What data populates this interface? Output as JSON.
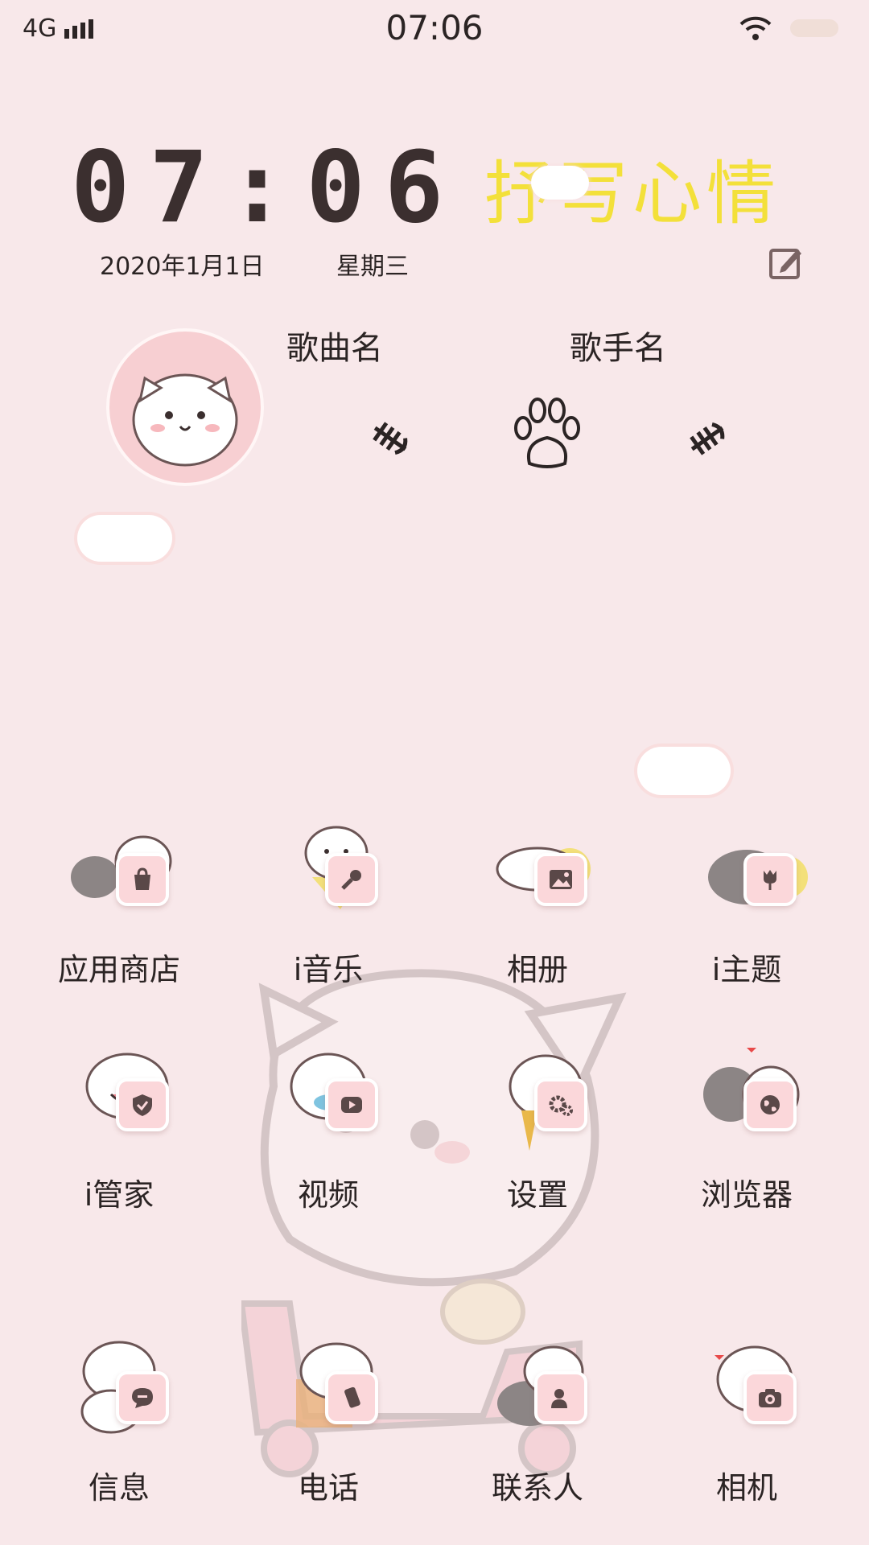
{
  "status_bar": {
    "network": "4G",
    "time": "07:06"
  },
  "clock_widget": {
    "time": "07:06",
    "mood_text": "抒写心情",
    "date": "2020年1月1日",
    "weekday": "星期三"
  },
  "music_widget": {
    "song_name": "歌曲名",
    "singer_name": "歌手名"
  },
  "apps": [
    {
      "label": "应用商店",
      "icon": "shopping-bag-icon"
    },
    {
      "label": "i音乐",
      "icon": "microphone-icon"
    },
    {
      "label": "相册",
      "icon": "photo-icon"
    },
    {
      "label": "i主题",
      "icon": "tulip-icon"
    },
    {
      "label": "i管家",
      "icon": "shield-icon"
    },
    {
      "label": "视频",
      "icon": "play-icon"
    },
    {
      "label": "设置",
      "icon": "gear-icon"
    },
    {
      "label": "浏览器",
      "icon": "globe-icon"
    },
    {
      "label": "信息",
      "icon": "message-icon"
    },
    {
      "label": "电话",
      "icon": "phone-icon"
    },
    {
      "label": "联系人",
      "icon": "contact-icon"
    },
    {
      "label": "相机",
      "icon": "camera-icon"
    }
  ],
  "colors": {
    "background": "#f8e8ea",
    "mood_text": "#f3e03a",
    "badge": "#fbd7da",
    "icon_dark": "#5a4848"
  }
}
